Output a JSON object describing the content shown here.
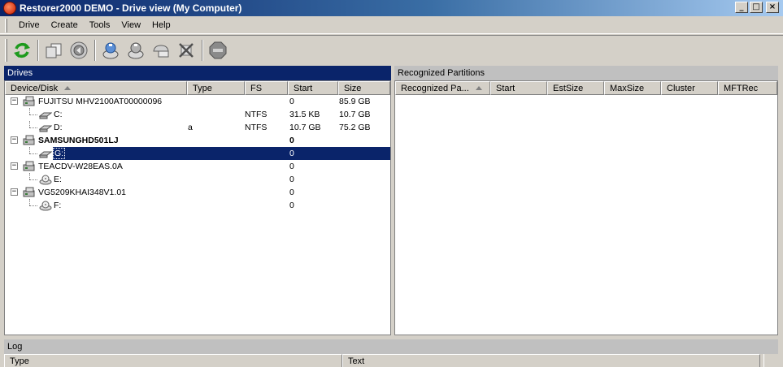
{
  "window": {
    "title": "Restorer2000 DEMO - Drive view (My Computer)",
    "controls": {
      "minimize": "_",
      "maximize": "□",
      "close": "×"
    }
  },
  "menu": [
    "Drive",
    "Create",
    "Tools",
    "View",
    "Help"
  ],
  "toolbar": {
    "buttons": [
      "refresh-icon",
      "copy-disk-icon",
      "disk-image-icon",
      "scan-icon",
      "find-icon",
      "scan-region-icon",
      "delete-icon",
      "stop-icon"
    ]
  },
  "drives": {
    "header": "Drives",
    "columns": [
      "Device/Disk",
      "Type",
      "FS",
      "Start",
      "Size"
    ],
    "rows": [
      {
        "name": "FUJITSU MHV2100AT00000096",
        "type": "",
        "fs": "",
        "start": "0",
        "size": "85.9 GB",
        "level": 0,
        "bold": false
      },
      {
        "name": "C:",
        "type": "",
        "fs": "NTFS",
        "start": "31.5 KB",
        "size": "10.7 GB",
        "level": 1,
        "bold": false
      },
      {
        "name": "D:",
        "type": "a",
        "fs": "NTFS",
        "start": "10.7 GB",
        "size": "75.2 GB",
        "level": 1,
        "bold": false
      },
      {
        "name": "SAMSUNGHD501LJ",
        "type": "",
        "fs": "",
        "start": "0",
        "size": "",
        "level": 0,
        "bold": true
      },
      {
        "name": "G:",
        "type": "",
        "fs": "",
        "start": "0",
        "size": "",
        "level": 1,
        "bold": false
      },
      {
        "name": "TEACDV-W28EAS.0A",
        "type": "",
        "fs": "",
        "start": "0",
        "size": "",
        "level": 0,
        "bold": false
      },
      {
        "name": "E:",
        "type": "",
        "fs": "",
        "start": "0",
        "size": "",
        "level": 1,
        "bold": false
      },
      {
        "name": "VG5209KHAI348V1.01",
        "type": "",
        "fs": "",
        "start": "0",
        "size": "",
        "level": 0,
        "bold": false
      },
      {
        "name": "F:",
        "type": "",
        "fs": "",
        "start": "0",
        "size": "",
        "level": 1,
        "bold": false
      }
    ]
  },
  "partitions": {
    "header": "Recognized Partitions",
    "columns": [
      "Recognized Pa...",
      "Start",
      "EstSize",
      "MaxSize",
      "Cluster",
      "MFTRec"
    ]
  },
  "log": {
    "header": "Log",
    "columns": [
      "Type",
      "Text"
    ]
  }
}
